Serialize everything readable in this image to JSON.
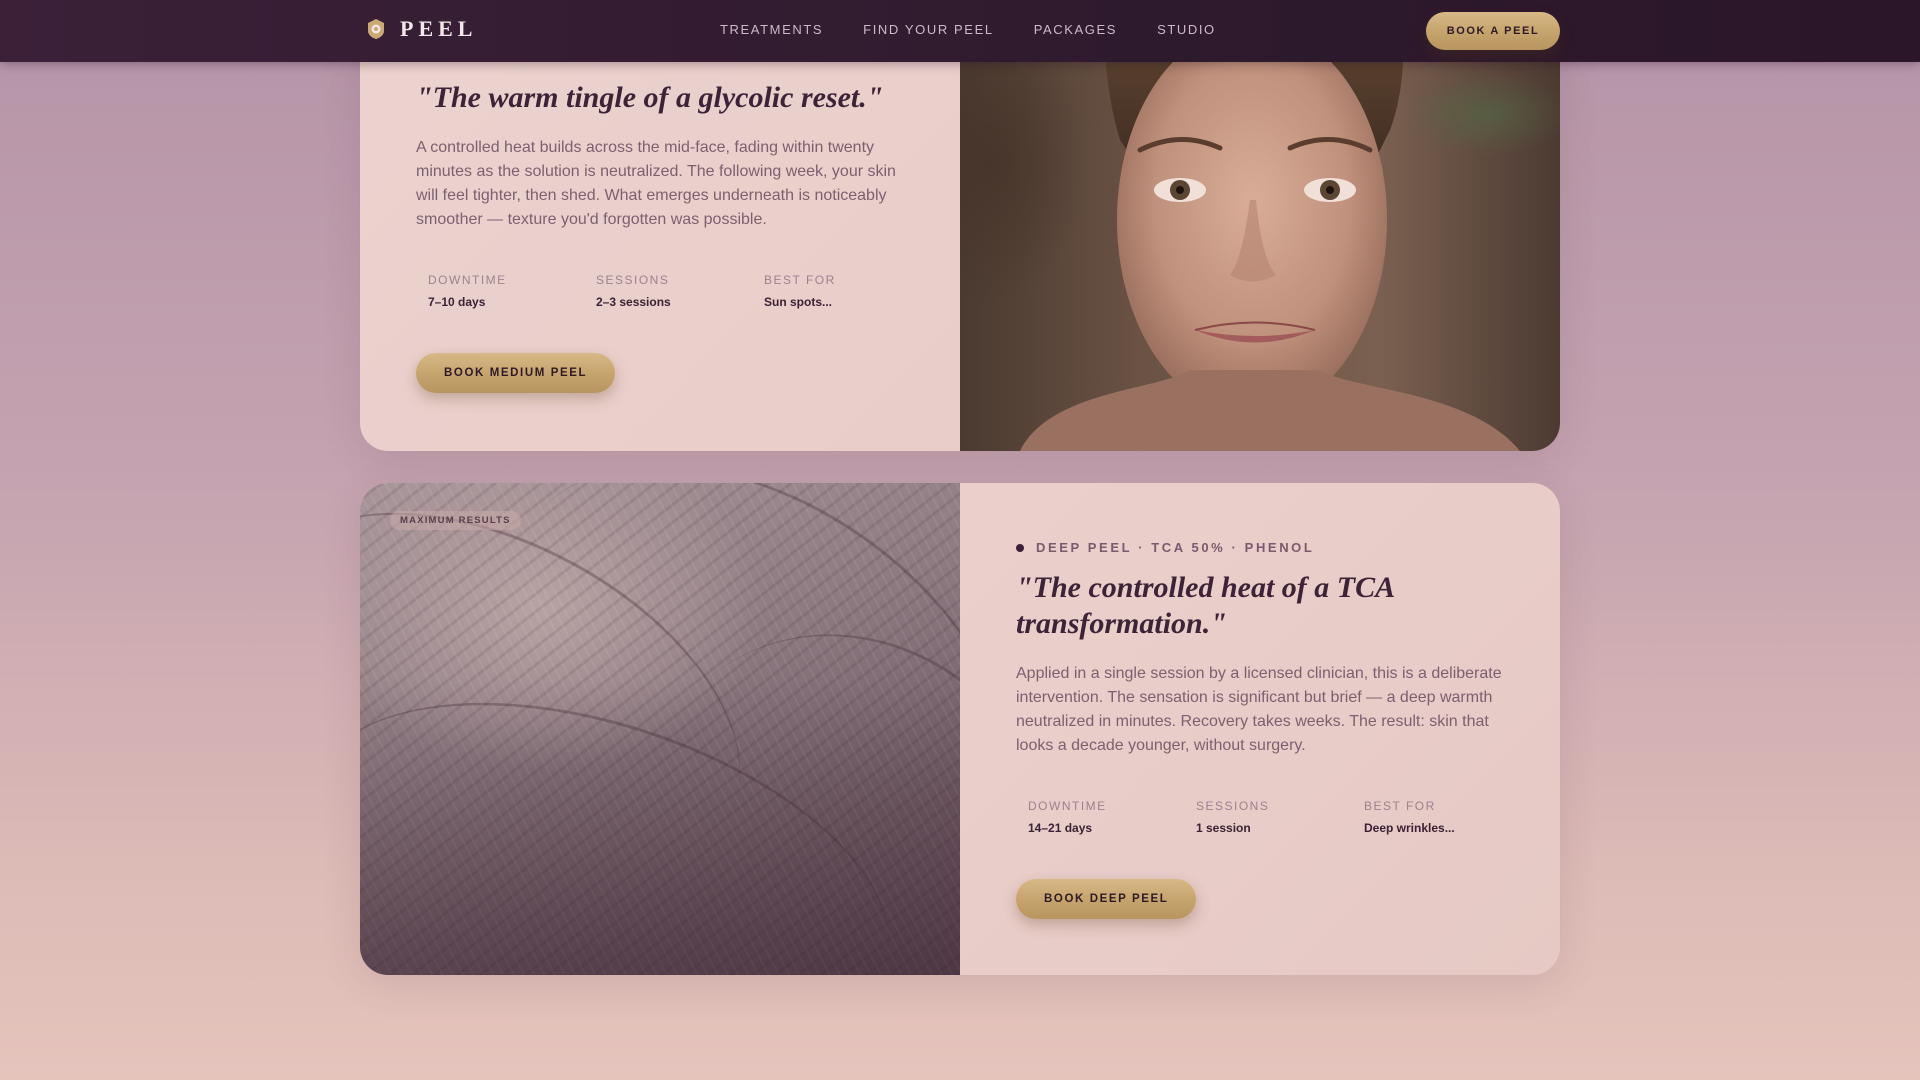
{
  "nav": {
    "brand": "PEEL",
    "links": [
      "TREATMENTS",
      "FIND YOUR PEEL",
      "PACKAGES",
      "STUDIO"
    ],
    "cta": "BOOK A PEEL"
  },
  "cards": [
    {
      "quote": "\"The warm tingle of a glycolic reset.\"",
      "description": "A controlled heat builds across the mid-face, fading within twenty minutes as the solution is neutralized. The following week, your skin will feel tighter, then shed. What emerges underneath is noticeably smoother — texture you'd forgotten was possible.",
      "stats": [
        {
          "label": "DOWNTIME",
          "value": "7–10 days"
        },
        {
          "label": "SESSIONS",
          "value": "2–3 sessions"
        },
        {
          "label": "BEST FOR",
          "value": "Sun spots..."
        }
      ],
      "button": "BOOK MEDIUM PEEL",
      "image": "woman-portrait"
    },
    {
      "badge": "MAXIMUM RESULTS",
      "kicker": "DEEP PEEL · TCA 50% · PHENOL",
      "quote": "\"The controlled heat of a TCA transformation.\"",
      "description": "Applied in a single session by a licensed clinician, this is a deliberate intervention. The sensation is significant but brief — a deep warmth neutralized in minutes. Recovery takes weeks. The result: skin that looks a decade younger, without surgery.",
      "stats": [
        {
          "label": "DOWNTIME",
          "value": "14–21 days"
        },
        {
          "label": "SESSIONS",
          "value": "1 session"
        },
        {
          "label": "BEST FOR",
          "value": "Deep wrinkles..."
        }
      ],
      "button": "BOOK DEEP PEEL",
      "image": "skin-texture-macro"
    }
  ],
  "colors": {
    "nav_bg": "#2e1a2d",
    "gold": "#c5a36c",
    "card_bg": "#ecd3cf",
    "heading": "#3d2338"
  }
}
